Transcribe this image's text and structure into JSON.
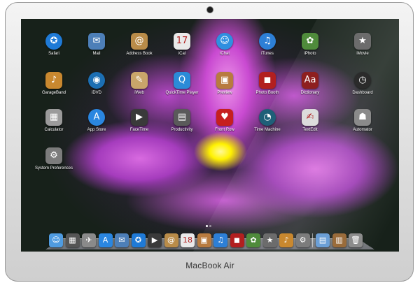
{
  "device": {
    "brand": "MacBook Air"
  },
  "launchpad": {
    "apps": [
      {
        "name": "Safari",
        "icon": "compass-icon",
        "glyph": "✪",
        "color": "#1f7ad6"
      },
      {
        "name": "Mail",
        "icon": "stamp-icon",
        "glyph": "✉",
        "color": "#4d7fb8"
      },
      {
        "name": "Address Book",
        "icon": "book-icon",
        "glyph": "@",
        "color": "#b98c49"
      },
      {
        "name": "iCal",
        "icon": "calendar-icon",
        "glyph": "17",
        "color": "#e9e9e9"
      },
      {
        "name": "iChat",
        "icon": "chat-icon",
        "glyph": "☺",
        "color": "#2f8fe0"
      },
      {
        "name": "iTunes",
        "icon": "music-icon",
        "glyph": "♫",
        "color": "#2d7fd6"
      },
      {
        "name": "iPhoto",
        "icon": "photo-icon",
        "glyph": "✿",
        "color": "#4f8b3b"
      },
      {
        "name": "iMovie",
        "icon": "star-icon",
        "glyph": "★",
        "color": "#6c6c6c"
      },
      {
        "name": "GarageBand",
        "icon": "guitar-icon",
        "glyph": "♪",
        "color": "#c9882f"
      },
      {
        "name": "iDVD",
        "icon": "dvd-icon",
        "glyph": "◉",
        "color": "#1c6fb3"
      },
      {
        "name": "iWeb",
        "icon": "web-icon",
        "glyph": "✎",
        "color": "#c9a56a"
      },
      {
        "name": "QuickTime Player",
        "icon": "quicktime-icon",
        "glyph": "Q",
        "color": "#2b8bd8"
      },
      {
        "name": "Preview",
        "icon": "preview-icon",
        "glyph": "▣",
        "color": "#b87b3f"
      },
      {
        "name": "Photo Booth",
        "icon": "photobooth-icon",
        "glyph": "◼",
        "color": "#b21f1f"
      },
      {
        "name": "Dictionary",
        "icon": "dictionary-icon",
        "glyph": "Aa",
        "color": "#8e1f1f"
      },
      {
        "name": "Dashboard",
        "icon": "gauge-icon",
        "glyph": "◷",
        "color": "#2b2b2b"
      },
      {
        "name": "Calculator",
        "icon": "calculator-icon",
        "glyph": "▦",
        "color": "#9b9b9b"
      },
      {
        "name": "App Store",
        "icon": "appstore-icon",
        "glyph": "A",
        "color": "#2a86e0"
      },
      {
        "name": "FaceTime",
        "icon": "video-camera-icon",
        "glyph": "▶",
        "color": "#3a3a3a"
      },
      {
        "name": "Productivity",
        "icon": "folder-icon",
        "glyph": "▤",
        "color": "#5a5a5a"
      },
      {
        "name": "Front Row",
        "icon": "chair-icon",
        "glyph": "♥",
        "color": "#c61f1f"
      },
      {
        "name": "Time Machine",
        "icon": "clock-icon",
        "glyph": "◔",
        "color": "#1f5f78"
      },
      {
        "name": "TextEdit",
        "icon": "textedit-icon",
        "glyph": "✍",
        "color": "#dcdcdc"
      },
      {
        "name": "Automator",
        "icon": "robot-icon",
        "glyph": "☗",
        "color": "#8a8a8a"
      },
      {
        "name": "System Preferences",
        "icon": "gear-icon",
        "glyph": "⚙",
        "color": "#7c7c7c"
      }
    ]
  },
  "page_indicator": {
    "pages": 2,
    "current": 1
  },
  "dock": {
    "items": [
      {
        "icon": "finder-icon",
        "glyph": "☺",
        "color": "#4f9be0"
      },
      {
        "icon": "mission-control-icon",
        "glyph": "▦",
        "color": "#555555"
      },
      {
        "icon": "launchpad-icon",
        "glyph": "✈",
        "color": "#8a8a8a"
      },
      {
        "icon": "appstore-icon",
        "glyph": "A",
        "color": "#2a86e0"
      },
      {
        "icon": "mail-icon",
        "glyph": "✉",
        "color": "#4d7fb8"
      },
      {
        "icon": "safari-icon",
        "glyph": "✪",
        "color": "#1f7ad6"
      },
      {
        "icon": "facetime-icon",
        "glyph": "▶",
        "color": "#3a3a3a"
      },
      {
        "icon": "addressbook-icon",
        "glyph": "@",
        "color": "#b98c49"
      },
      {
        "icon": "ical-icon",
        "glyph": "18",
        "color": "#e9e9e9"
      },
      {
        "icon": "preview-icon",
        "glyph": "▣",
        "color": "#b87b3f"
      },
      {
        "icon": "itunes-icon",
        "glyph": "♫",
        "color": "#2d7fd6"
      },
      {
        "icon": "photobooth-icon",
        "glyph": "◼",
        "color": "#b21f1f"
      },
      {
        "icon": "iphoto-icon",
        "glyph": "✿",
        "color": "#4f8b3b"
      },
      {
        "icon": "imovie-icon",
        "glyph": "★",
        "color": "#6c6c6c"
      },
      {
        "icon": "garageband-icon",
        "glyph": "♪",
        "color": "#c9882f"
      },
      {
        "icon": "system-preferences-icon",
        "glyph": "⚙",
        "color": "#7c7c7c"
      },
      {
        "icon": "applications-folder-icon",
        "glyph": "▤",
        "color": "#6b9fd6"
      },
      {
        "icon": "documents-stack-icon",
        "glyph": "▥",
        "color": "#9a6c3b"
      },
      {
        "icon": "trash-icon",
        "glyph": "🗑",
        "color": "#8c8c8c"
      }
    ]
  }
}
